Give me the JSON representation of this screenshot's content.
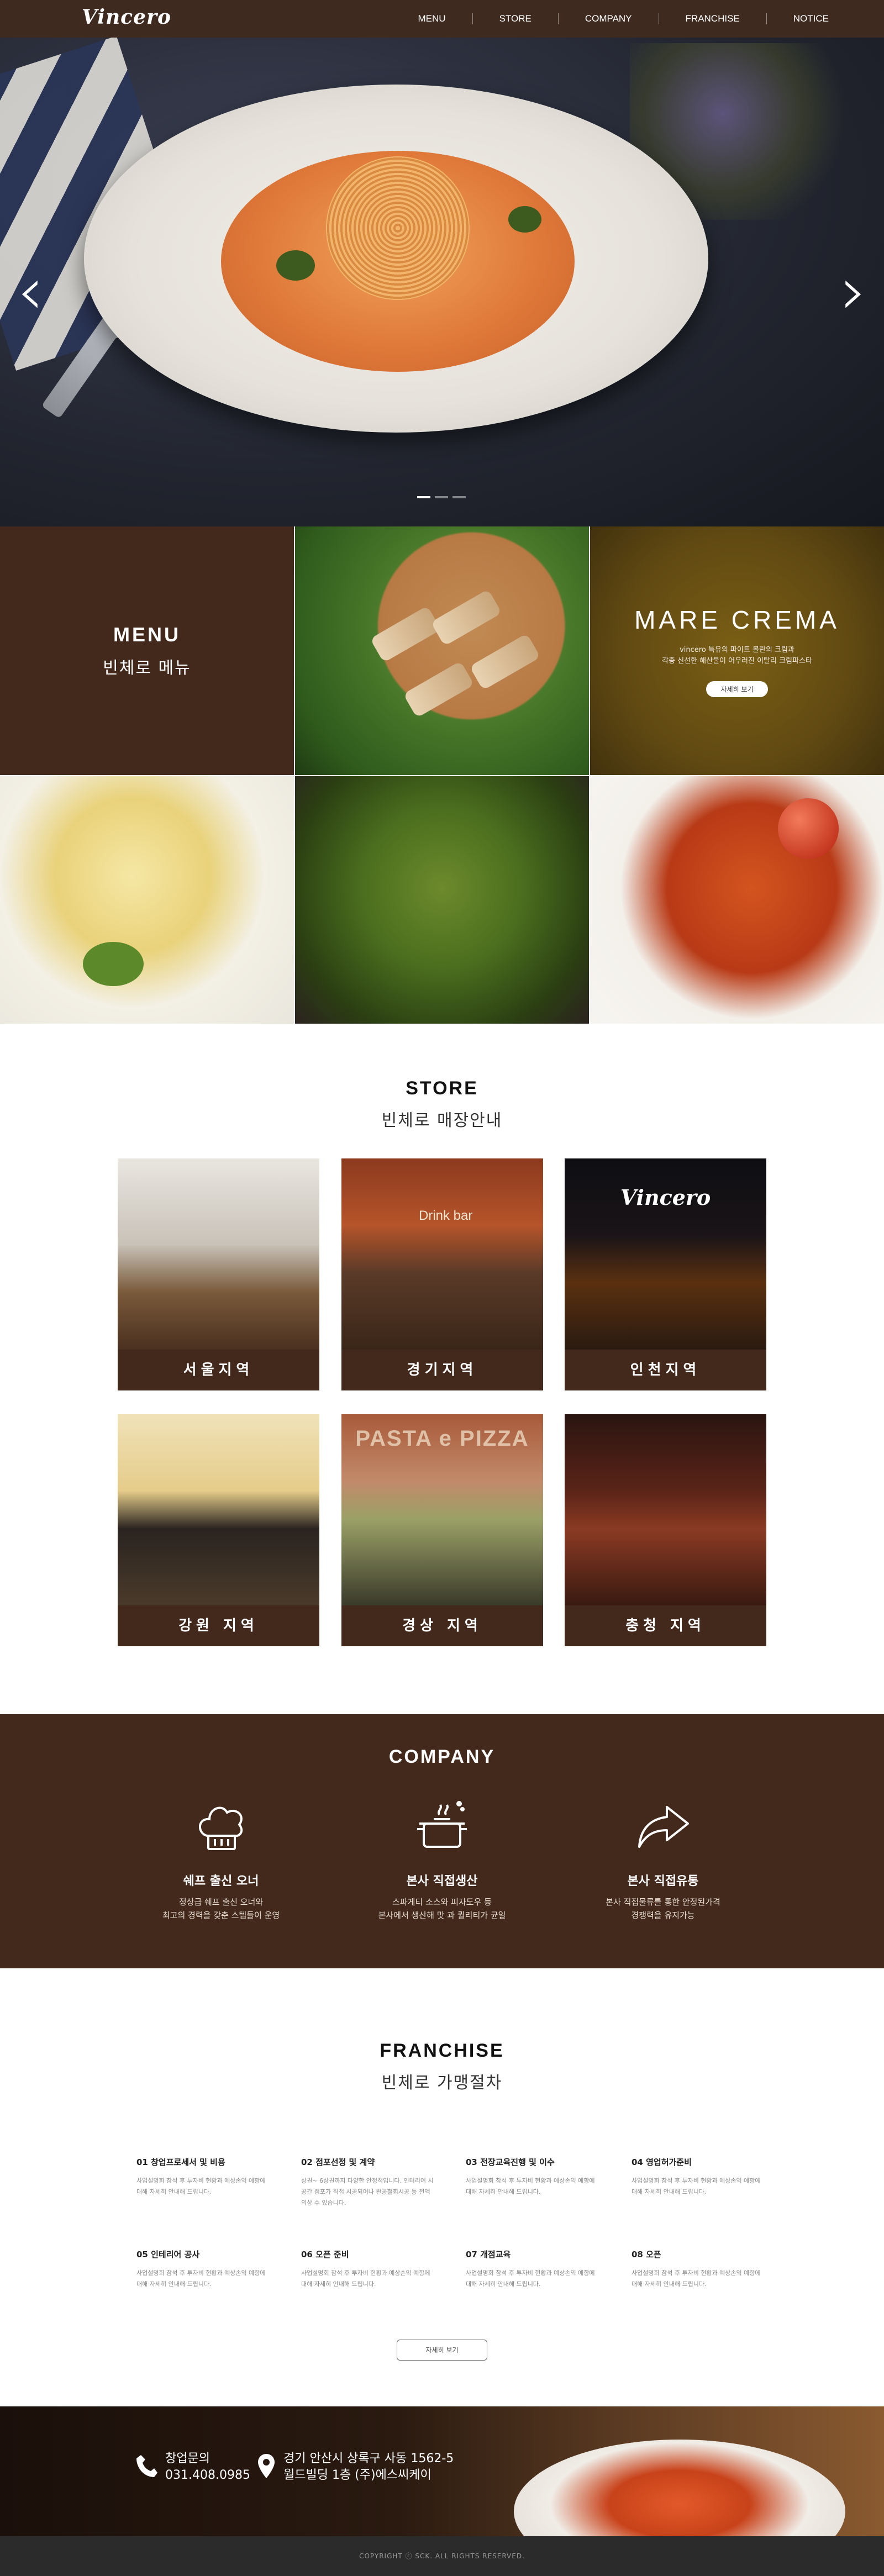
{
  "brand": {
    "logo": "Vincero"
  },
  "nav": [
    "MENU",
    "STORE",
    "COMPANY",
    "FRANCHISE",
    "NOTICE"
  ],
  "hero": {
    "slide_count": 3,
    "active_slide": 1
  },
  "menu": {
    "title": "MENU",
    "subtitle": "빈체로 메뉴",
    "feature": {
      "title": "MARE CREMA",
      "desc_line1": "vincero 특유의 파이트 볼란의 크림과",
      "desc_line2": "각종 신선한 해산물이 어우러진 이탈리 크림파스타",
      "button": "자세히 보기"
    }
  },
  "store": {
    "title": "STORE",
    "subtitle": "빈체로 매장안내",
    "photo_signs": {
      "gyeonggi": "Drink bar",
      "incheon": "Vincero",
      "gyeongsang": "PASTA e PIZZA"
    },
    "regions": [
      "서울지역",
      "경기지역",
      "인천지역",
      "강원 지역",
      "경상 지역",
      "충청 지역"
    ]
  },
  "company": {
    "title": "COMPANY",
    "features": [
      {
        "icon": "chef-hat-icon",
        "title": "쉐프 출신 오너",
        "line1": "정상급 쉐프 출신 오너와",
        "line2": "최고의 경력을 갖춘 스텝들이 운영"
      },
      {
        "icon": "cooking-pot-icon",
        "title": "본사 직접생산",
        "line1": "스파게티 소스와 피자도우 등",
        "line2": "본사에서 생산해 맛 과 퀄리티가 균일"
      },
      {
        "icon": "share-arrow-icon",
        "title": "본사 직접유통",
        "line1": "본사 직접물류를 통한 안정된가격",
        "line2": "경쟁력을 유지가능"
      }
    ]
  },
  "franchise": {
    "title": "FRANCHISE",
    "subtitle": "빈체로 가맹절차",
    "steps": [
      {
        "title": "01 창업프로세서 및 비용",
        "desc": "사업설명회 참석 후 투자비 현황과 예상손익 예항에 대해 자세히 안내해 드립니다."
      },
      {
        "title": "02 점포선정 및 계약",
        "desc": "상권~ 6상권까지 다양한 안정적입니다. 인터리어 시공간 점포가 직접 시공되어나 완공철회시공 등 전액 의상 수 있습니다."
      },
      {
        "title": "03 전장교육진행 및 이수",
        "desc": "사업설명회 참석 후 투자비 현황과 예상손익 예항에 대해 자세히 안내해 드립니다."
      },
      {
        "title": "04 영업허가준비",
        "desc": "사업설명회 참석 후 투자비 현황과 예상손익 예항에 대해 자세히 안내해 드립니다."
      },
      {
        "title": "05 인테리어 공사",
        "desc": "사업설명회 참석 후 투자비 현황과 예상손익 예항에 대해 자세히 안내해 드립니다."
      },
      {
        "title": "06 오픈 준비",
        "desc": "사업설명회 참석 후 투자비 현황과 예상손익 예항에 대해 자세히 안내해 드립니다."
      },
      {
        "title": "07 개점교육",
        "desc": "사업설명회 참석 후 투자비 현황과 예상손익 예항에 대해 자세히 안내해 드립니다."
      },
      {
        "title": "08 오픈",
        "desc": "사업설명회 참석 후 투자비 현황과 예상손익 예항에 대해 자세히 안내해 드립니다."
      }
    ],
    "button": "자세히 보기"
  },
  "contact": {
    "phone_label": "창업문의",
    "phone": "031.408.0985",
    "address_line1": "경기 안산시 상록구 사동 1562-5",
    "address_line2": "월드빌딩 1층 (주)에스씨케이"
  },
  "footer": {
    "copyright": "COPYRIGHT ⓒ SCK. ALL RIGHTS RESERVED."
  }
}
